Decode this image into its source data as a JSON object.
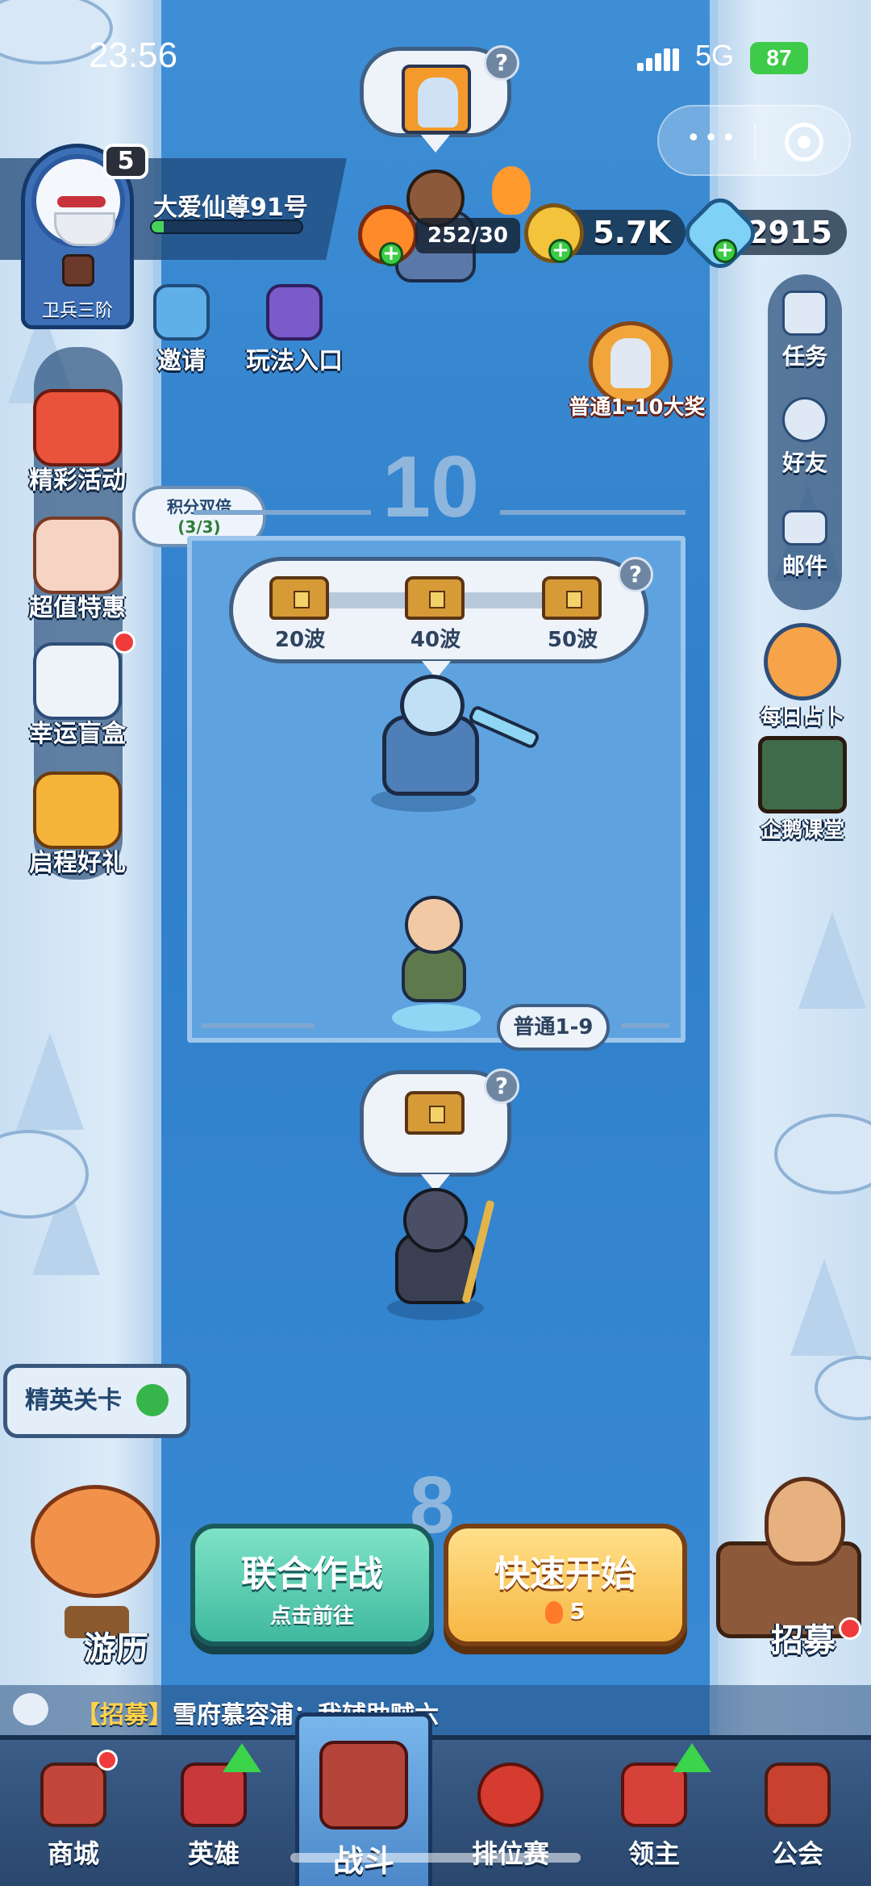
{
  "status_bar": {
    "time": "23:56",
    "network": "5G",
    "battery": "87"
  },
  "player": {
    "level": "5",
    "name": "大爱仙尊91号",
    "rank": "卫兵三阶",
    "exp_fraction": 0.08
  },
  "resources": {
    "stamina": "252/30",
    "gold": "5.7K",
    "gems": "2915"
  },
  "top_entries": [
    {
      "label": "邀请",
      "icon": "invite-penguin-icon"
    },
    {
      "label": "玩法入口",
      "icon": "gamepad-icon"
    }
  ],
  "left_menu": [
    {
      "label": "精彩活动",
      "icon": "lucky-bag-icon"
    },
    {
      "label": "超值特惠",
      "icon": "cake-icon"
    },
    {
      "label": "幸运盲盒",
      "icon": "clover-card-icon"
    },
    {
      "label": "启程好礼",
      "icon": "phoenix-icon"
    }
  ],
  "double_points": {
    "title": "积分双倍",
    "count": "(3/3)"
  },
  "right_menu": [
    {
      "label": "任务",
      "icon": "task-icon"
    },
    {
      "label": "好友",
      "icon": "friends-icon"
    },
    {
      "label": "邮件",
      "icon": "mail-icon"
    }
  ],
  "right_extras": [
    {
      "label": "每日占卜",
      "icon": "crystal-ball-icon"
    },
    {
      "label": "企鹅课堂",
      "icon": "penguin-class-icon"
    }
  ],
  "grand_prize": {
    "label": "普通1-10大奖"
  },
  "stage": {
    "current_number": "10",
    "next_number": "8",
    "chests": [
      {
        "label": "20波"
      },
      {
        "label": "40波"
      },
      {
        "label": "50波"
      }
    ],
    "stage_tag": "普通1-9",
    "help": "?"
  },
  "buttons": {
    "elite": "精英关卡",
    "travel": "游历",
    "coop_title": "联合作战",
    "coop_sub": "点击前往",
    "quick_title": "快速开始",
    "quick_cost": "5",
    "recruit": "招募"
  },
  "chat": {
    "tag": "【招募】",
    "message": "雪府慕容浦：我辅助贼六"
  },
  "nav": [
    {
      "label": "商城",
      "icon": "shop-chest-icon"
    },
    {
      "label": "英雄",
      "icon": "hero-card-icon"
    },
    {
      "label": "战斗",
      "icon": "battle-rockets-icon"
    },
    {
      "label": "排位赛",
      "icon": "knot-icon"
    },
    {
      "label": "领主",
      "icon": "scroll-icon"
    },
    {
      "label": "公会",
      "icon": "guild-hall-icon"
    }
  ],
  "colors": {
    "river": "#3f8fd6",
    "snow": "#dcebf8",
    "accent_green": "#3fb9a0",
    "accent_gold": "#f7b642"
  }
}
